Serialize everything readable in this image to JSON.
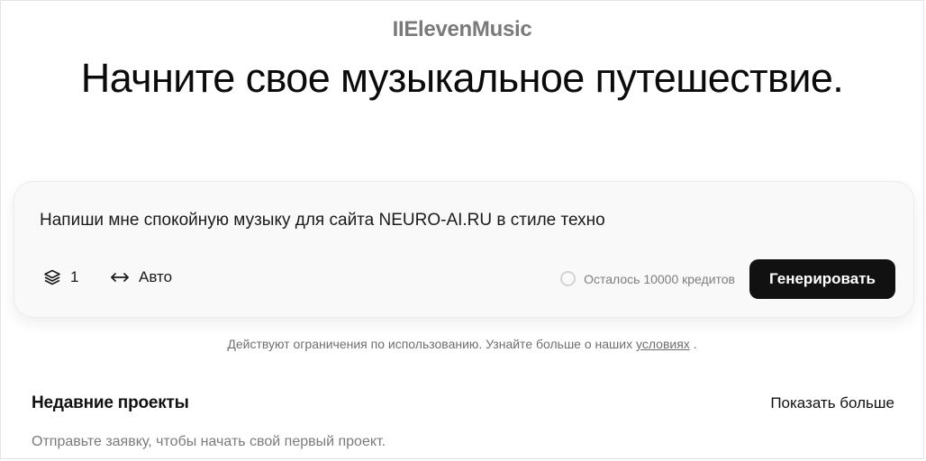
{
  "header": {
    "brand": "IIElevenMusic",
    "title": "Начните свое музыкальное путешествие."
  },
  "prompt": {
    "text": "Напиши мне спокойную музыку для сайта NEURO-AI.RU в стиле техно",
    "count_value": "1",
    "count_icon": "layers-icon",
    "duration_value": "Авто",
    "duration_icon": "arrows-horizontal-icon",
    "credits_text": "Осталось 10000 кредитов",
    "generate_label": "Генерировать"
  },
  "notice": {
    "text_before": "Действуют ограничения по использованию. Узнайте больше о наших",
    "link_label": "условиях",
    "text_after": "."
  },
  "recent": {
    "title": "Недавние проекты",
    "show_more_label": "Показать больше",
    "empty_message": "Отправьте заявку, чтобы начать свой первый проект."
  },
  "colors": {
    "accent_button": "#111111",
    "card_background": "#f9f9f9",
    "muted_text": "#7d7d7d"
  }
}
